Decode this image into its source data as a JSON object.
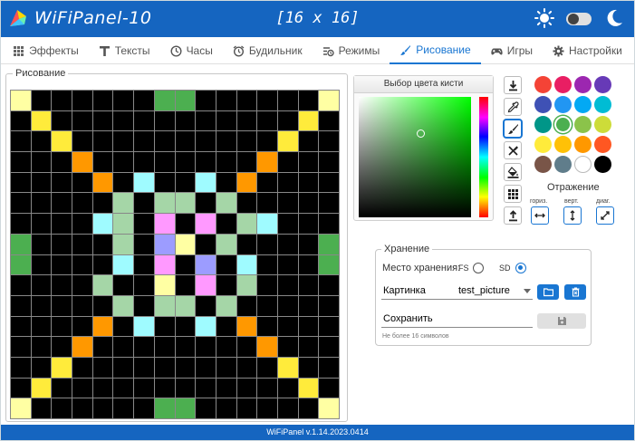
{
  "app": {
    "title": "WiFiPanel-10",
    "matrix_size": "[16 x 16]",
    "version": "WiFiPanel v.1.14.2023.0414"
  },
  "tabs": [
    {
      "label": "Эффекты",
      "icon": "effects-icon"
    },
    {
      "label": "Тексты",
      "icon": "text-icon"
    },
    {
      "label": "Часы",
      "icon": "clock-icon"
    },
    {
      "label": "Будильник",
      "icon": "alarm-icon"
    },
    {
      "label": "Режимы",
      "icon": "modes-icon"
    },
    {
      "label": "Рисование",
      "icon": "brush-icon",
      "active": true
    },
    {
      "label": "Игры",
      "icon": "gamepad-icon"
    },
    {
      "label": "Настройки",
      "icon": "settings-icon"
    }
  ],
  "drawing": {
    "legend": "Рисование",
    "palette_map": {
      "k": "#000000",
      "y": "#ffffa3",
      "Y": "#ffeb3b",
      "o": "#ff9800",
      "g": "#4caf50",
      "c": "#9ffbff",
      "m": "#a5d6a7",
      "p": "#ff99ff",
      "b": "#9c9cff"
    },
    "matrix": [
      "ykkkkkkggkkkkkky",
      "kYkkkkkkkkkkkkYk",
      "kkYkkkkkkkkkkYkk",
      "kkkokkkkkkkkokkk",
      "kkkkokckkckokkkk",
      "kkkkkmkmmkmkkkkk",
      "kkkkcmkpkpkmckkk",
      "gkkkkmkbykmkkkkg",
      "gkkkkckpkbkckkkg",
      "kkkkmkkykpkmkkkk",
      "kkkkkmkmmkmkkkkk",
      "kkkkokckkckokkkk",
      "kkkokkkkkkkkokkk",
      "kkYkkkkkkkkkkYkk",
      "kYkkkkkkkkkkkkYk",
      "ykkkkkkggkkkkkky"
    ]
  },
  "picker": {
    "title": "Выбор цвета кисти",
    "selected_color": "#00ff00"
  },
  "tools": [
    {
      "name": "download-button",
      "icon": "download-icon"
    },
    {
      "name": "eyedropper-button",
      "icon": "eyedropper-icon"
    },
    {
      "name": "brush-tool-button",
      "icon": "brush-icon",
      "active": true
    },
    {
      "name": "clear-button",
      "icon": "clear-icon"
    },
    {
      "name": "fill-button",
      "icon": "fill-icon"
    },
    {
      "name": "grid-button",
      "icon": "grid-icon"
    },
    {
      "name": "upload-button",
      "icon": "upload-icon"
    }
  ],
  "palette": [
    "#f44336",
    "#e91e63",
    "#9c27b0",
    "#673ab7",
    "#3f51b5",
    "#2196f3",
    "#03a9f4",
    "#00bcd4",
    "#009688",
    "#4caf50",
    "#8bc34a",
    "#cddc39",
    "#ffeb3b",
    "#ffc107",
    "#ff9800",
    "#ff5722",
    "#795548",
    "#607d8b",
    "#ffffff",
    "#000000"
  ],
  "mirror": {
    "title": "Отражение",
    "horizontal": "гориз.",
    "vertical": "верт.",
    "diagonal": "диаг."
  },
  "storage": {
    "legend": "Хранение",
    "location_label": "Место хранения:",
    "fs_label": "FS",
    "sd_label": "SD",
    "selected": "SD",
    "picture_label": "Картинка",
    "picture_value": "test_picture",
    "save_placeholder": "Сохранить",
    "hint": "Не более 16 символов"
  }
}
